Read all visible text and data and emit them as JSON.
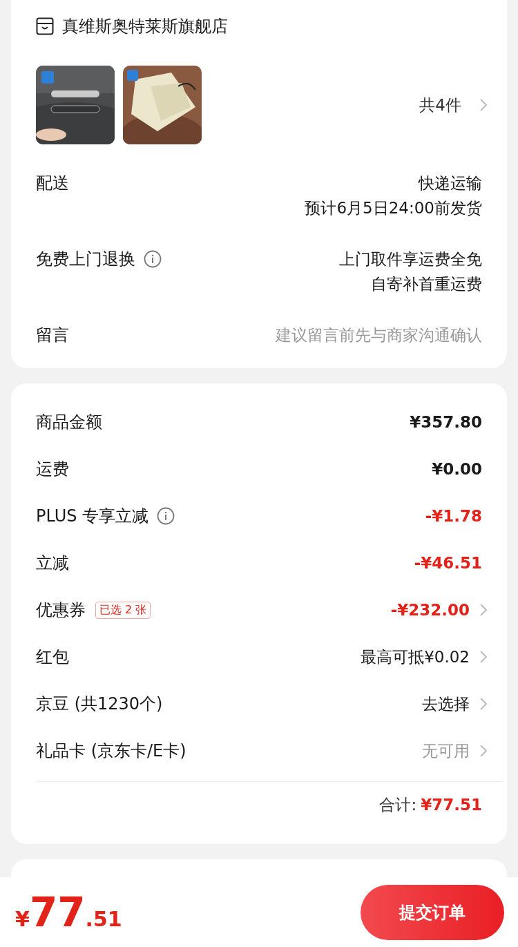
{
  "store": {
    "name": "真维斯奥特莱斯旗舰店"
  },
  "products": {
    "count": "共4件"
  },
  "order_info": [
    {
      "label": "配送",
      "lines": [
        "快递运输",
        "预计6月5日24:00前发货"
      ],
      "info": false,
      "kind": "value"
    },
    {
      "label": "免费上门退换",
      "lines": [
        "上门取件享运费全免",
        "自寄补首重运费"
      ],
      "info": true,
      "kind": "value"
    },
    {
      "label": "留言",
      "lines": [
        "建议留言前先与商家沟通确认"
      ],
      "info": false,
      "kind": "placeholder"
    }
  ],
  "price_rows": [
    {
      "label": "商品金额",
      "value": "¥357.80",
      "kind": "normal",
      "info": false,
      "chevron": false
    },
    {
      "label": "运费",
      "value": "¥0.00",
      "kind": "normal",
      "info": false,
      "chevron": false
    },
    {
      "label": "PLUS 专享立减",
      "value": "-¥1.78",
      "kind": "discount",
      "info": true,
      "chevron": false
    },
    {
      "label": "立减",
      "value": "-¥46.51",
      "kind": "discount",
      "info": false,
      "chevron": false
    },
    {
      "label": "优惠券",
      "tag": "已选 2 张",
      "value": "-¥232.00",
      "kind": "discount",
      "info": false,
      "chevron": true
    },
    {
      "label": "红包",
      "value": "最高可抵¥0.02",
      "kind": "plain",
      "info": false,
      "chevron": true
    },
    {
      "label": "京豆 (共1230个)",
      "value": "去选择",
      "kind": "plain",
      "info": false,
      "chevron": true
    },
    {
      "label": "礼品卡 (京东卡/E卡)",
      "value": "无可用",
      "kind": "muted",
      "info": false,
      "chevron": true
    }
  ],
  "total": {
    "label": "合计:",
    "value": "¥77.51"
  },
  "footer": {
    "currency": "¥",
    "integer": "77",
    "decimal": ".51",
    "submit": "提交订单"
  }
}
